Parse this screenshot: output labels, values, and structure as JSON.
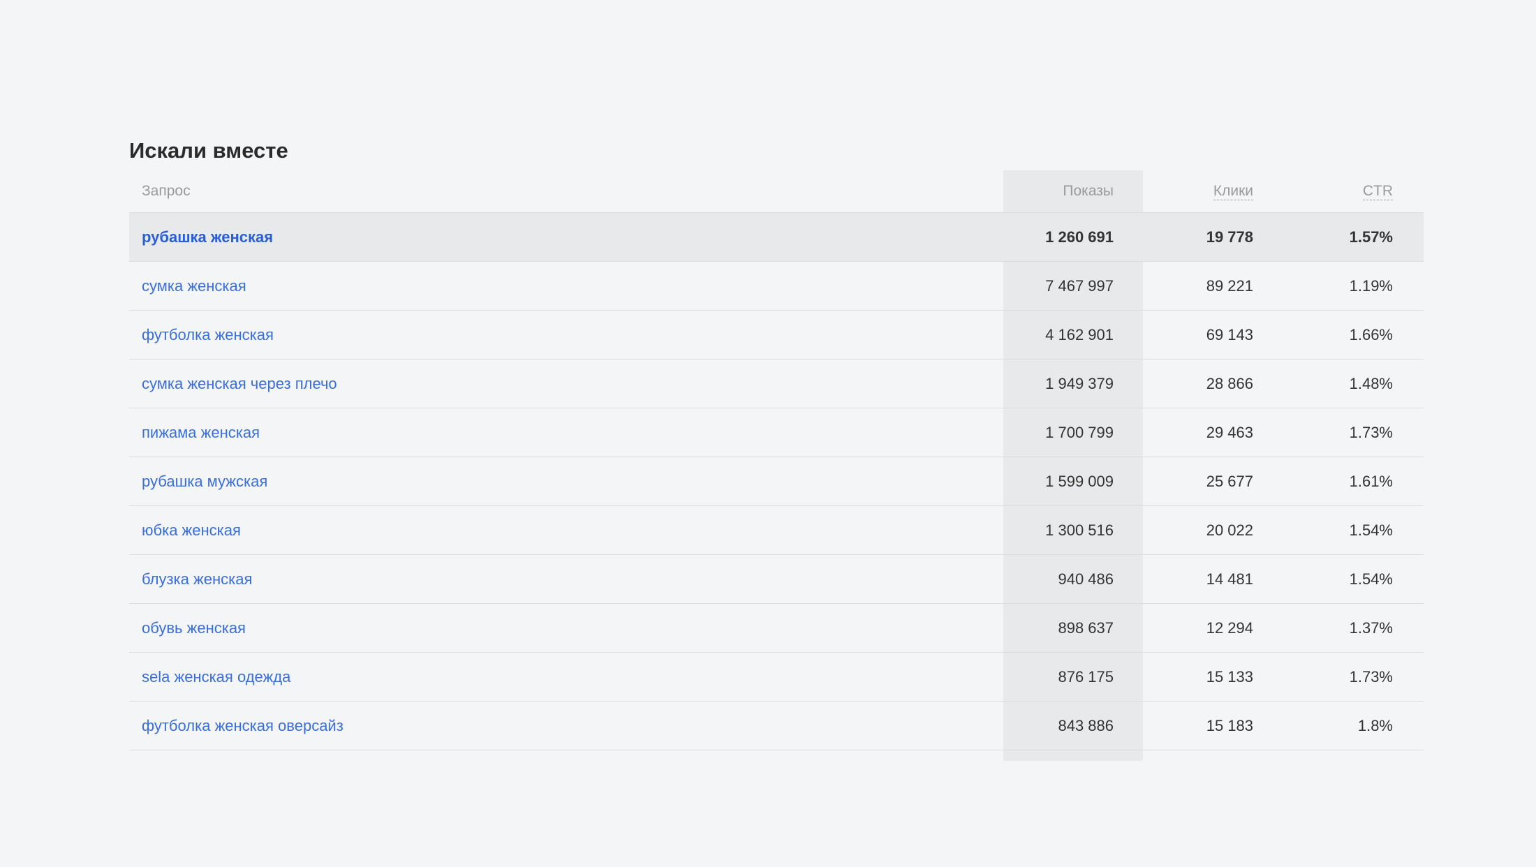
{
  "section": {
    "title": "Искали вместе"
  },
  "table": {
    "headers": {
      "query": "Запрос",
      "shows": "Показы",
      "clicks": "Клики",
      "ctr": "CTR"
    },
    "highlight": {
      "query": "рубашка женская",
      "shows": "1 260 691",
      "clicks": "19 778",
      "ctr": "1.57%"
    },
    "rows": [
      {
        "query": "сумка женская",
        "shows": "7 467 997",
        "clicks": "89 221",
        "ctr": "1.19%"
      },
      {
        "query": "футболка женская",
        "shows": "4 162 901",
        "clicks": "69 143",
        "ctr": "1.66%"
      },
      {
        "query": "сумка женская через плечо",
        "shows": "1 949 379",
        "clicks": "28 866",
        "ctr": "1.48%"
      },
      {
        "query": "пижама женская",
        "shows": "1 700 799",
        "clicks": "29 463",
        "ctr": "1.73%"
      },
      {
        "query": "рубашка мужская",
        "shows": "1 599 009",
        "clicks": "25 677",
        "ctr": "1.61%"
      },
      {
        "query": "юбка женская",
        "shows": "1 300 516",
        "clicks": "20 022",
        "ctr": "1.54%"
      },
      {
        "query": "блузка женская",
        "shows": "940 486",
        "clicks": "14 481",
        "ctr": "1.54%"
      },
      {
        "query": "обувь женская",
        "shows": "898 637",
        "clicks": "12 294",
        "ctr": "1.37%"
      },
      {
        "query": "sela женская одежда",
        "shows": "876 175",
        "clicks": "15 133",
        "ctr": "1.73%"
      },
      {
        "query": "футболка женская оверсайз",
        "shows": "843 886",
        "clicks": "15 183",
        "ctr": "1.8%"
      }
    ]
  },
  "colors": {
    "background": "#f3f5f7",
    "link": "#3b6fd8",
    "highlight_bg": "#e8e9ea",
    "sorted_column_bg": "#e8e9ea"
  }
}
